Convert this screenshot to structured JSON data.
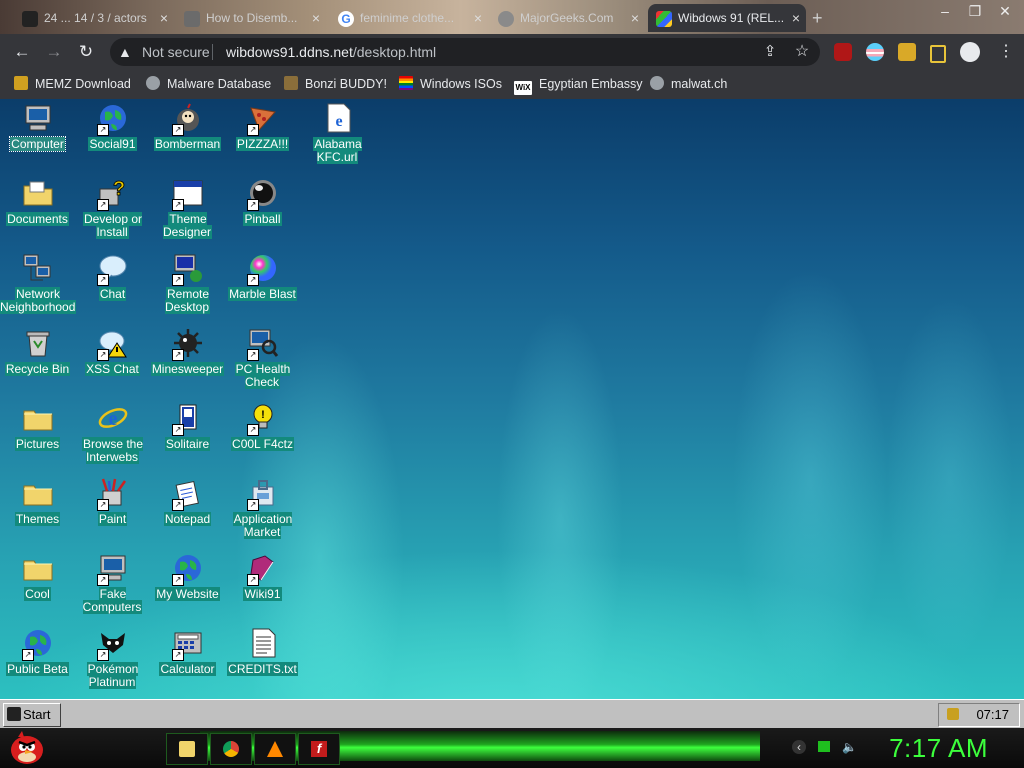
{
  "browser": {
    "tabs": [
      {
        "label": "24 ... 14 / 3 / actors",
        "active": false
      },
      {
        "label": "How to Disemb...",
        "active": false
      },
      {
        "label": "feminime clothe...",
        "active": false
      },
      {
        "label": "MajorGeeks.Com",
        "active": false
      },
      {
        "label": "Wibdows 91 (REL...",
        "active": true
      }
    ],
    "new_tab_icon": "plus-icon",
    "security_label": "Not secure",
    "url_host": "wibdows91.ddns.net",
    "url_path": "/desktop.html",
    "bookmarks": [
      {
        "label": "MEMZ Download",
        "icon": "globe-icon"
      },
      {
        "label": "Malware Database",
        "icon": "globe-icon"
      },
      {
        "label": "Bonzi BUDDY!",
        "icon": "bonzi-icon"
      },
      {
        "label": "Windows ISOs",
        "icon": "rainbow-icon"
      },
      {
        "label": "Egyptian Embassy",
        "icon": "wix-icon"
      },
      {
        "label": "malwat.ch",
        "icon": "globe-icon"
      }
    ]
  },
  "desktop": {
    "icons": [
      {
        "label": "Computer",
        "icon": "computer-icon",
        "col": 0,
        "row": 0,
        "shortcut": false,
        "selected": true
      },
      {
        "label": "Social91",
        "icon": "globe-icon",
        "col": 1,
        "row": 0,
        "shortcut": true
      },
      {
        "label": "Bomberman",
        "icon": "bomberman-icon",
        "col": 2,
        "row": 0,
        "shortcut": true
      },
      {
        "label": "PIZZZA!!!",
        "icon": "pizza-icon",
        "col": 3,
        "row": 0,
        "shortcut": true
      },
      {
        "label": "Alabama KFC.url",
        "icon": "ie-document-icon",
        "col": 4,
        "row": 0,
        "shortcut": false
      },
      {
        "label": "Documents",
        "icon": "folder-docs-icon",
        "col": 0,
        "row": 1,
        "shortcut": false
      },
      {
        "label": "Develop or Install",
        "icon": "help-setup-icon",
        "col": 1,
        "row": 1,
        "shortcut": true
      },
      {
        "label": "Theme Designer",
        "icon": "window-icon",
        "col": 2,
        "row": 1,
        "shortcut": true
      },
      {
        "label": "Pinball",
        "icon": "pinball-icon",
        "col": 3,
        "row": 1,
        "shortcut": true
      },
      {
        "label": "Network Neighborhood",
        "icon": "network-icon",
        "col": 0,
        "row": 2,
        "shortcut": false
      },
      {
        "label": "Chat",
        "icon": "chat-icon",
        "col": 1,
        "row": 2,
        "shortcut": true
      },
      {
        "label": "Remote Desktop",
        "icon": "remote-desktop-icon",
        "col": 2,
        "row": 2,
        "shortcut": true
      },
      {
        "label": "Marble Blast",
        "icon": "marble-icon",
        "col": 3,
        "row": 2,
        "shortcut": true
      },
      {
        "label": "Recycle Bin",
        "icon": "recycle-bin-icon",
        "col": 0,
        "row": 3,
        "shortcut": false
      },
      {
        "label": "XSS Chat",
        "icon": "xss-chat-icon",
        "col": 1,
        "row": 3,
        "shortcut": true
      },
      {
        "label": "Minesweeper",
        "icon": "mine-icon",
        "col": 2,
        "row": 3,
        "shortcut": true
      },
      {
        "label": "PC Health Check",
        "icon": "health-check-icon",
        "col": 3,
        "row": 3,
        "shortcut": true
      },
      {
        "label": "Pictures",
        "icon": "folder-icon",
        "col": 0,
        "row": 4,
        "shortcut": false
      },
      {
        "label": "Browse the Interwebs",
        "icon": "ie-icon",
        "col": 1,
        "row": 4,
        "shortcut": false
      },
      {
        "label": "Solitaire",
        "icon": "solitaire-icon",
        "col": 2,
        "row": 4,
        "shortcut": true
      },
      {
        "label": "C00L F4ctz",
        "icon": "tip-icon",
        "col": 3,
        "row": 4,
        "shortcut": true
      },
      {
        "label": "Themes",
        "icon": "folder-icon",
        "col": 0,
        "row": 5,
        "shortcut": false
      },
      {
        "label": "Paint",
        "icon": "paint-icon",
        "col": 1,
        "row": 5,
        "shortcut": true
      },
      {
        "label": "Notepad",
        "icon": "notepad-icon",
        "col": 2,
        "row": 5,
        "shortcut": true
      },
      {
        "label": "Application Market",
        "icon": "market-icon",
        "col": 3,
        "row": 5,
        "shortcut": true
      },
      {
        "label": "Cool",
        "icon": "folder-icon",
        "col": 0,
        "row": 6,
        "shortcut": false
      },
      {
        "label": "Fake Computers",
        "icon": "computer-icon",
        "col": 1,
        "row": 6,
        "shortcut": true
      },
      {
        "label": "My Website",
        "icon": "globe-icon",
        "col": 2,
        "row": 6,
        "shortcut": true
      },
      {
        "label": "Wiki91",
        "icon": "book-icon",
        "col": 3,
        "row": 6,
        "shortcut": true
      },
      {
        "label": "Public Beta",
        "icon": "globe-icon",
        "col": 0,
        "row": 7,
        "shortcut": true
      },
      {
        "label": "Pokémon Platinum",
        "icon": "pokemon-icon",
        "col": 1,
        "row": 7,
        "shortcut": true
      },
      {
        "label": "Calculator",
        "icon": "calculator-icon",
        "col": 2,
        "row": 7,
        "shortcut": true
      },
      {
        "label": "CREDITS.txt",
        "icon": "text-file-icon",
        "col": 3,
        "row": 7,
        "shortcut": false
      }
    ]
  },
  "taskbar91": {
    "start_label": "Start",
    "clock": "07:17"
  },
  "host": {
    "clock": "7:17 AM",
    "pinned": [
      "folder-icon",
      "chrome-icon",
      "vlc-icon",
      "flash-icon"
    ]
  },
  "colors": {
    "label_bg": "#138a7c",
    "clock_green": "#3cff3c"
  }
}
